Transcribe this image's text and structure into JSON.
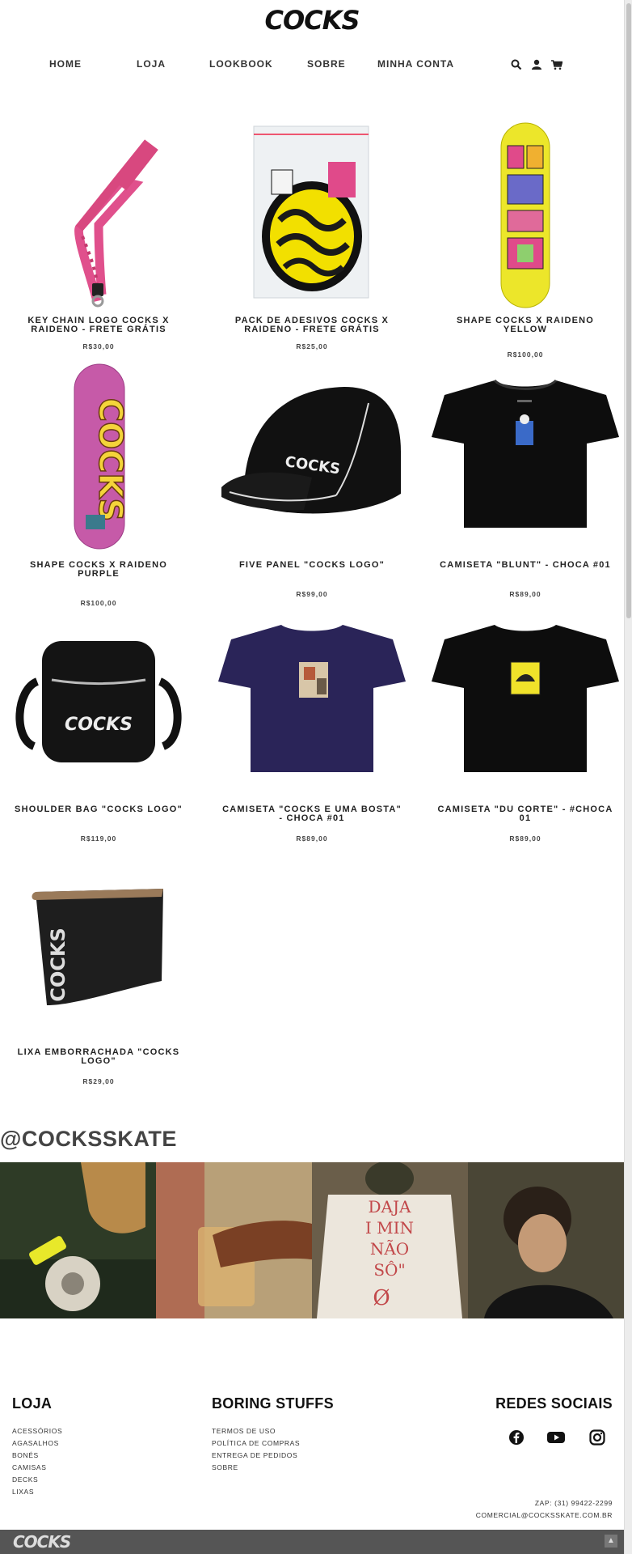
{
  "brand": {
    "logo_text": "COCKS"
  },
  "nav": {
    "items": [
      "HOME",
      "LOJA",
      "LOOKBOOK",
      "SOBRE",
      "MINHA CONTA"
    ],
    "icons": [
      "search-icon",
      "user-icon",
      "cart-icon"
    ]
  },
  "products": [
    {
      "name": "KEY CHAIN LOGO COCKS X RAIDENO - FRETE GRÁTIS",
      "price": "R$30,00",
      "image": "pink lanyard keychain"
    },
    {
      "name": "PACK DE ADESIVOS COCKS X RAIDENO - FRETE GRÁTIS",
      "price": "R$25,00",
      "image": "sticker pack in plastic bag"
    },
    {
      "name": "SHAPE COCKS X RAIDENO YELLOW",
      "price": "R$100,00",
      "image": "yellow skateboard deck"
    },
    {
      "name": "SHAPE COCKS X RAIDENO PURPLE",
      "price": "R$100,00",
      "image": "purple skateboard deck"
    },
    {
      "name": "FIVE PANEL \"COCKS LOGO\"",
      "price": "R$99,00",
      "image": "black five panel cap"
    },
    {
      "name": "CAMISETA \"BLUNT\" - CHOCA #01",
      "price": "R$89,00",
      "image": "black t-shirt with blue print"
    },
    {
      "name": "SHOULDER BAG \"COCKS LOGO\"",
      "price": "R$119,00",
      "image": "black shoulder bag"
    },
    {
      "name": "CAMISETA \"COCKS E UMA BOSTA\" - CHOCA #01",
      "price": "R$89,00",
      "image": "navy t-shirt with photo print"
    },
    {
      "name": "CAMISETA \"DU CORTE\" - #CHOCA 01",
      "price": "R$89,00",
      "image": "black t-shirt with yellow print"
    },
    {
      "name": "LIXA EMBORRACHADA \"COCKS LOGO\"",
      "price": "R$29,00",
      "image": "black griptape roll"
    }
  ],
  "instagram": {
    "handle": "@COCKSSKATE",
    "tiles": [
      "hand with lighter and ashtray",
      "hand holding glass",
      "white t-shirt with red text",
      "curly haired man"
    ],
    "tile3_text": [
      "DAJA",
      "I MIN",
      "NÃO",
      "SÔ\"",
      "Ø"
    ]
  },
  "footer": {
    "loja": {
      "title": "LOJA",
      "items": [
        "ACESSÓRIOS",
        "AGASALHOS",
        "BONÉS",
        "CAMISAS",
        "DECKS",
        "LIXAS"
      ]
    },
    "boring": {
      "title": "BORING STUFFS",
      "items": [
        "TERMOS DE USO",
        "POLÍTICA DE COMPRAS",
        "ENTREGA DE PEDIDOS",
        "SOBRE"
      ]
    },
    "social": {
      "title": "REDES SOCIAIS",
      "icons": [
        "facebook-icon",
        "youtube-icon",
        "instagram-icon"
      ]
    },
    "contact": {
      "phone": "ZAP: (31) 99422-2299",
      "email": "COMERCIAL@COCKSSKATE.COM.BR"
    },
    "bottom_logo": "COCKS",
    "back_to_top": "▲"
  },
  "colors": {
    "nav_text": "#333333",
    "footer_bar": "#555555",
    "insta_title": "#444444"
  }
}
